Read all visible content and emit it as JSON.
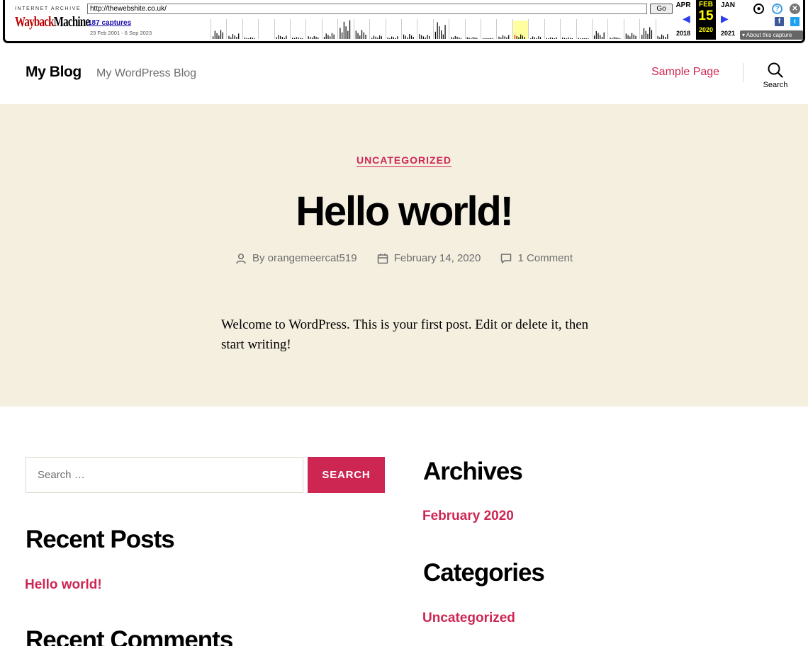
{
  "wayback": {
    "ia_label": "INTERNET ARCHIVE",
    "logo_wayback": "Wayback",
    "logo_machine": "Machine",
    "url": "http://thewebshite.co.uk/",
    "go_label": "Go",
    "captures": "187 captures",
    "range": "23 Feb 2001 - 6 Sep 2023",
    "prev_month": "APR",
    "cur_month": "FEB",
    "next_month": "JAN",
    "cur_day": "15",
    "prev_year": "2018",
    "cur_year": "2020",
    "next_year": "2021",
    "about_capture": "About this capture",
    "sparkline_year_bars": [
      0.5,
      0.3,
      0.1,
      0.0,
      0.2,
      0.1,
      0.15,
      0.3,
      0.95,
      0.5,
      0.2,
      0.15,
      0.3,
      0.25,
      0.85,
      0.15,
      0.1,
      0.05,
      0.2,
      0.25,
      0.15,
      0.1,
      0.1,
      0.05,
      0.4,
      0.1,
      0.3,
      0.6,
      0.25
    ]
  },
  "header": {
    "site_title": "My Blog",
    "site_description": "My WordPress Blog",
    "nav_link": "Sample Page",
    "search_label": "Search"
  },
  "entry": {
    "category": "UNCATEGORIZED",
    "title": "Hello world!",
    "author": "By orangemeercat519",
    "date": "February 14, 2020",
    "comments": "1 Comment",
    "content": "Welcome to WordPress. This is your first post. Edit or delete it, then start writing!"
  },
  "widgets": {
    "search_placeholder": "Search …",
    "search_button": "SEARCH",
    "recent_posts_title": "Recent Posts",
    "recent_posts_link": "Hello world!",
    "recent_comments_title": "Recent Comments",
    "archives_title": "Archives",
    "archives_link": "February 2020",
    "categories_title": "Categories",
    "categories_link": "Uncategorized"
  },
  "colors": {
    "accent": "#cd2653",
    "entry_background": "#f5efe0",
    "meta_text": "#6d6d6d"
  }
}
